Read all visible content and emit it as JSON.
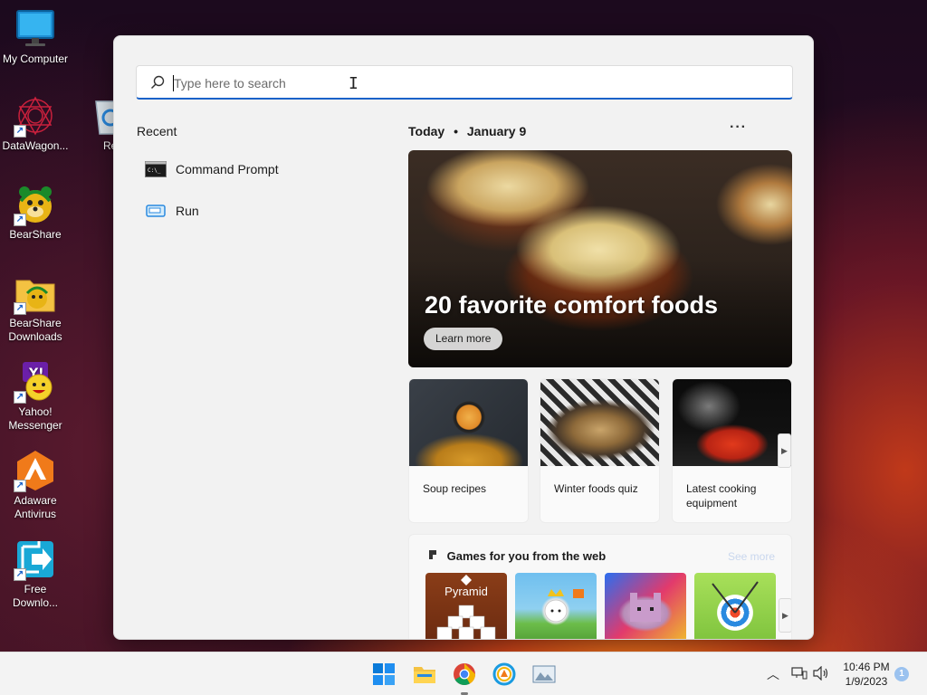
{
  "desktop": {
    "icons": [
      {
        "label": "My Computer"
      },
      {
        "label": "DataWagon..."
      },
      {
        "label": "Recycle"
      },
      {
        "label": "BearShare"
      },
      {
        "label": "BearShare Downloads"
      },
      {
        "label": "Yahoo! Messenger"
      },
      {
        "label": "Adaware Antivirus"
      },
      {
        "label": "Free Downlo..."
      }
    ]
  },
  "start_menu": {
    "search": {
      "placeholder": "Type here to search"
    },
    "recent": {
      "title": "Recent",
      "items": [
        {
          "label": "Command Prompt",
          "icon": "command-prompt-icon"
        },
        {
          "label": "Run",
          "icon": "run-icon"
        }
      ]
    },
    "today": {
      "label": "Today",
      "separator": "•",
      "date": "January 9"
    },
    "more": "···",
    "hero": {
      "headline": "20 favorite comfort foods",
      "button": "Learn more"
    },
    "cards": [
      {
        "caption": "Soup recipes"
      },
      {
        "caption": "Winter foods quiz"
      },
      {
        "caption": "Latest cooking equipment"
      }
    ],
    "games": {
      "title": "Games for you from the web",
      "see_more": "See more",
      "tiles": [
        {
          "label": "Pyramid"
        },
        {
          "label": ""
        },
        {
          "label": ""
        },
        {
          "label": ""
        }
      ]
    }
  },
  "taskbar": {
    "apps": [
      "start-icon",
      "file-explorer-icon",
      "chrome-icon",
      "browser-icon",
      "image-viewer-icon"
    ],
    "clock": {
      "time": "10:46 PM",
      "date": "1/9/2023"
    },
    "notification_count": "1"
  }
}
